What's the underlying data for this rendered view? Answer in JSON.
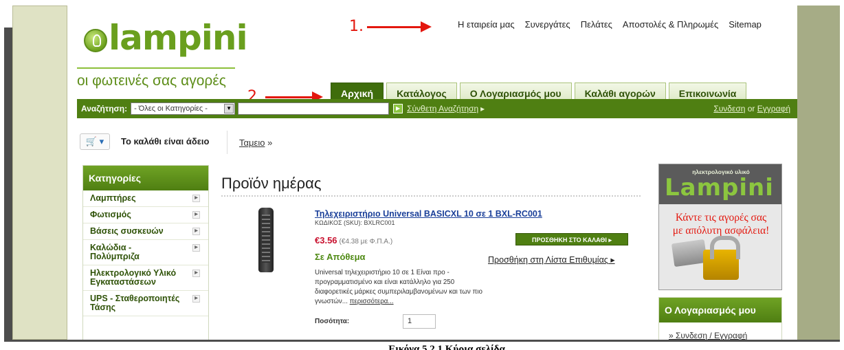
{
  "brand": {
    "logo_text": "lampini",
    "tagline": "οι φωτεινές σας αγορές"
  },
  "top_links": [
    "Η εταιρεία μας",
    "Συνεργάτες",
    "Πελάτες",
    "Αποστολές & Πληρωμές",
    "Sitemap"
  ],
  "annotations": {
    "one": "1.",
    "two": "2."
  },
  "tabs": [
    "Αρχική",
    "Κατάλογος",
    "Ο Λογαριασμός μου",
    "Καλάθι αγορών",
    "Επικοινωνία"
  ],
  "search": {
    "label": "Αναζήτηση:",
    "category": "- Όλες οι Κατηγορίες -",
    "query": "",
    "advanced": "Σύνθετη Αναζήτηση",
    "login": "Συνδεση",
    "or": "or",
    "register": "Εγγραφή"
  },
  "cart": {
    "empty_text": "Το καλάθι είναι άδειο",
    "checkout": "Ταμειο",
    "checkout_suffix": "»"
  },
  "categories": {
    "title": "Κατηγορίες",
    "items": [
      "Λαμπτήρες",
      "Φωτισμός",
      "Βάσεις συσκευών",
      "Καλώδια - Πολύμπριζα",
      "Ηλεκτρολογικό Υλικό Εγκαταστάσεων",
      "UPS - Σταθεροποιητές Τάσης"
    ]
  },
  "product": {
    "section_title": "Προϊόν ημέρας",
    "name": "Τηλεχειριστήριο Universal BASICXL 10 σε 1 BXL-RC001",
    "sku": "ΚΩΔΙΚΟΣ (SKU): BXLRC001",
    "price": "€3.56",
    "price_vat": "(€4.38 με Φ.Π.Α.)",
    "add_to_cart": "ΠΡΟΣΘΗΚΗ ΣΤΟ ΚΑΛΑΘΙ",
    "stock": "Σε Απόθεμα",
    "wishlist": "Προσθήκη στη Λίστα Επιθυμίας",
    "description": "Universal τηλεχειριστήριο 10 σε 1 Είναι προ - προγραμματισμένο και είναι κατάλληλο για 250 διαφορετικές μάρκες συμπεριλαμβανομένων και των πιο γνωστών...",
    "more": "περισσότερα...",
    "qty_label": "Ποσότητα:",
    "qty_value": "1"
  },
  "banner": {
    "top": "ηλεκτρολογικό υλικό",
    "logo": "Lampini",
    "slogan_line1": "Κάντε τις αγορές σας",
    "slogan_line2": "με απόλυτη ασφάλεια!"
  },
  "account": {
    "title": "Ο Λογαριασμός μου",
    "link": "» Συνδεση / Εγγραφή"
  },
  "caption": "Εικόνα 5.2.1 Κύρια σελίδα",
  "colors": {
    "brand_green": "#4f7f12",
    "accent_red": "#e3170e",
    "link_blue": "#1a3f99"
  }
}
